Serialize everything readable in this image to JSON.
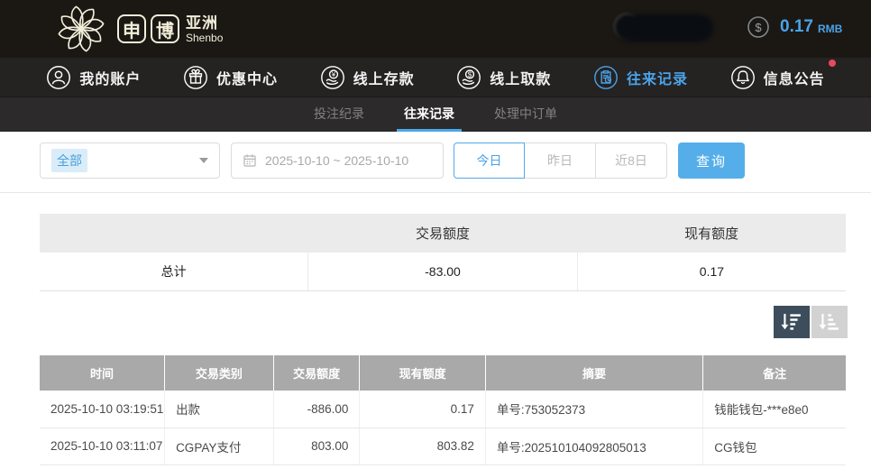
{
  "header": {
    "logo": {
      "char1": "申",
      "char2": "博",
      "region": "亚洲",
      "subtitle": "Shenbo"
    },
    "balance": {
      "amount": "0.17",
      "currency": "RMB"
    }
  },
  "nav": {
    "items": [
      {
        "label": "我的账户",
        "icon": "user-icon",
        "active": false
      },
      {
        "label": "优惠中心",
        "icon": "gift-icon",
        "active": false
      },
      {
        "label": "线上存款",
        "icon": "deposit-hand-coin-icon",
        "active": false
      },
      {
        "label": "线上取款",
        "icon": "withdraw-hand-coin-icon",
        "active": false
      },
      {
        "label": "往来记录",
        "icon": "records-clipboard-icon",
        "active": true
      },
      {
        "label": "信息公告",
        "icon": "bell-icon",
        "active": false,
        "badge": true
      }
    ]
  },
  "subnav": {
    "tabs": [
      {
        "label": "投注纪录",
        "active": false
      },
      {
        "label": "往来记录",
        "active": true
      },
      {
        "label": "处理中订单",
        "active": false
      }
    ]
  },
  "filters": {
    "type_select": {
      "value": "全部"
    },
    "date_range": {
      "value": "2025-10-10 ~ 2025-10-10"
    },
    "quick_buttons": [
      {
        "label": "今日",
        "active": true
      },
      {
        "label": "昨日",
        "active": false
      },
      {
        "label": "近8日",
        "active": false
      }
    ],
    "search_label": "查询"
  },
  "summary_table": {
    "headers": {
      "amount": "交易额度",
      "balance": "现有额度"
    },
    "total_row": {
      "label": "总计",
      "amount": "-83.00",
      "balance": "0.17"
    }
  },
  "records_table": {
    "headers": [
      "时间",
      "交易类别",
      "交易额度",
      "现有额度",
      "摘要",
      "备注"
    ],
    "rows": [
      {
        "time": "2025-10-10 03:19:51",
        "type": "出款",
        "amount": "-886.00",
        "balance": "0.17",
        "summary": "单号:753052373",
        "remark": "钱能钱包-***e8e0"
      },
      {
        "time": "2025-10-10 03:11:07",
        "type": "CGPAY支付",
        "amount": "803.00",
        "balance": "803.82",
        "summary": "单号:202510104092805013",
        "remark": "CG钱包"
      }
    ]
  },
  "icons": [
    "flower-logo-icon",
    "dollar-coin-icon",
    "user-icon",
    "gift-icon",
    "deposit-hand-coin-icon",
    "withdraw-hand-coin-icon",
    "records-clipboard-icon",
    "bell-icon",
    "calendar-icon",
    "caret-down-icon",
    "sort-desc-icon",
    "sort-asc-icon"
  ],
  "colors": {
    "accent": "#4aa3e8",
    "notification_badge": "#e8495f",
    "search_button": "#55aee9",
    "table_header_bg": "#a9a9a9",
    "sort_active_bg": "#3d4d5c"
  }
}
